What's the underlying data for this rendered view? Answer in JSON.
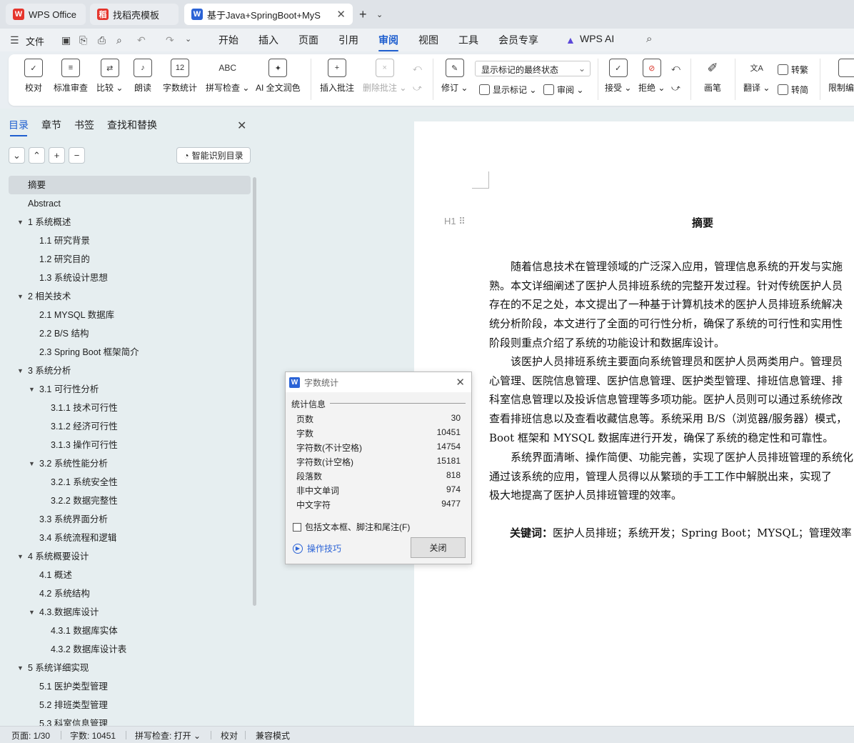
{
  "tabs": [
    {
      "label": "WPS Office",
      "logo": "W"
    },
    {
      "label": "找稻壳模板",
      "logo": "稻"
    },
    {
      "label": "基于Java+SpringBoot+MyS",
      "logo": "W"
    }
  ],
  "menu": {
    "file": "文件",
    "items": [
      "开始",
      "插入",
      "页面",
      "引用",
      "审阅",
      "视图",
      "工具",
      "会员专享"
    ],
    "active": "审阅",
    "ai": "WPS AI"
  },
  "ribbon": {
    "proofread": "校对",
    "standard_review": "标准审查",
    "compare": "比较",
    "read_aloud": "朗读",
    "word_count": "字数统计",
    "spell_check": "拼写检查",
    "ai_polish": "AI 全文润色",
    "insert_comment": "插入批注",
    "delete_comment": "删除批注",
    "track_changes": "修订",
    "markup_select": "显示标记的最终状态",
    "show_markup": "显示标记",
    "review": "审阅",
    "accept": "接受",
    "reject": "拒绝",
    "pen": "画笔",
    "translate": "翻译",
    "to_traditional": "转繁",
    "to_simplified": "转简",
    "restrict": "限制编"
  },
  "nav": {
    "tabs": [
      "目录",
      "章节",
      "书签",
      "查找和替换"
    ],
    "smart_toc": "智能识别目录",
    "toc": [
      {
        "label": "摘要",
        "level": 0
      },
      {
        "label": "Abstract",
        "level": 0
      },
      {
        "label": "1 系统概述",
        "level": 0,
        "expandable": true
      },
      {
        "label": "1.1  研究背景",
        "level": 1
      },
      {
        "label": "1.2 研究目的",
        "level": 1
      },
      {
        "label": "1.3 系统设计思想",
        "level": 1
      },
      {
        "label": "2 相关技术",
        "level": 0,
        "expandable": true
      },
      {
        "label": "2.1 MYSQL 数据库",
        "level": 1
      },
      {
        "label": "2.2 B/S 结构",
        "level": 1
      },
      {
        "label": "2.3 Spring Boot 框架简介",
        "level": 1
      },
      {
        "label": "3 系统分析",
        "level": 0,
        "expandable": true
      },
      {
        "label": "3.1 可行性分析",
        "level": 1,
        "expandable": true
      },
      {
        "label": "3.1.1 技术可行性",
        "level": 2
      },
      {
        "label": "3.1.2 经济可行性",
        "level": 2
      },
      {
        "label": "3.1.3 操作可行性",
        "level": 2
      },
      {
        "label": "3.2 系统性能分析",
        "level": 1,
        "expandable": true
      },
      {
        "label": "3.2.1  系统安全性",
        "level": 2
      },
      {
        "label": "3.2.2  数据完整性",
        "level": 2
      },
      {
        "label": "3.3 系统界面分析",
        "level": 1
      },
      {
        "label": "3.4 系统流程和逻辑",
        "level": 1
      },
      {
        "label": "4 系统概要设计",
        "level": 0,
        "expandable": true
      },
      {
        "label": "4.1 概述",
        "level": 1
      },
      {
        "label": "4.2 系统结构",
        "level": 1
      },
      {
        "label": "4.3.数据库设计",
        "level": 1,
        "expandable": true
      },
      {
        "label": "4.3.1 数据库实体",
        "level": 2
      },
      {
        "label": "4.3.2 数据库设计表",
        "level": 2
      },
      {
        "label": "5 系统详细实现",
        "level": 0,
        "expandable": true
      },
      {
        "label": "5.1  医护类型管理",
        "level": 1
      },
      {
        "label": "5.2  排班类型管理",
        "level": 1
      },
      {
        "label": "5.3  科室信息管理",
        "level": 1
      }
    ]
  },
  "document": {
    "title": "摘要",
    "heading_marker": "H1",
    "paragraphs": [
      [
        "随着信息技术在管理领域的广泛深入应用，管理信息系统的开发与实施",
        "熟。本文详细阐述了医护人员排班系统的完整开发过程。针对传统医护人员",
        "存在的不足之处，本文提出了一种基于计算机技术的医护人员排班系统解决",
        "统分析阶段，本文进行了全面的可行性分析，确保了系统的可行性和实用性",
        "阶段则重点介绍了系统的功能设计和数据库设计。"
      ],
      [
        "该医护人员排班系统主要面向系统管理员和医护人员两类用户。管理员",
        "心管理、医院信息管理、医护信息管理、医护类型管理、排班信息管理、排",
        "科室信息管理以及投诉信息管理等多项功能。医护人员则可以通过系统修改",
        "查看排班信息以及查看收藏信息等。系统采用 B/S（浏览器/服务器）模式，",
        "Boot 框架和 MYSQL 数据库进行开发，确保了系统的稳定性和可靠性。"
      ],
      [
        "系统界面清晰、操作简便、功能完善，实现了医护人员排班管理的系统化",
        "通过该系统的应用，管理人员得以从繁琐的手工工作中解脱出来，实现了",
        "极大地提高了医护人员排班管理的效率。"
      ]
    ],
    "keywords_label": "关键词：",
    "keywords": "医护人员排班；系统开发；Spring Boot；MYSQL；管理效率"
  },
  "dialog": {
    "title": "字数统计",
    "section": "统计信息",
    "stats": [
      {
        "label": "页数",
        "value": "30"
      },
      {
        "label": "字数",
        "value": "10451"
      },
      {
        "label": "字符数(不计空格)",
        "value": "14754"
      },
      {
        "label": "字符数(计空格)",
        "value": "15181"
      },
      {
        "label": "段落数",
        "value": "818"
      },
      {
        "label": "非中文单词",
        "value": "974"
      },
      {
        "label": "中文字符",
        "value": "9477"
      }
    ],
    "checkbox": "包括文本框、脚注和尾注(F)",
    "tips": "操作技巧",
    "close": "关闭"
  },
  "status": {
    "page": "页面: 1/30",
    "words": "字数: 10451",
    "spell": "拼写检查: 打开",
    "proof": "校对",
    "compat": "兼容模式"
  }
}
